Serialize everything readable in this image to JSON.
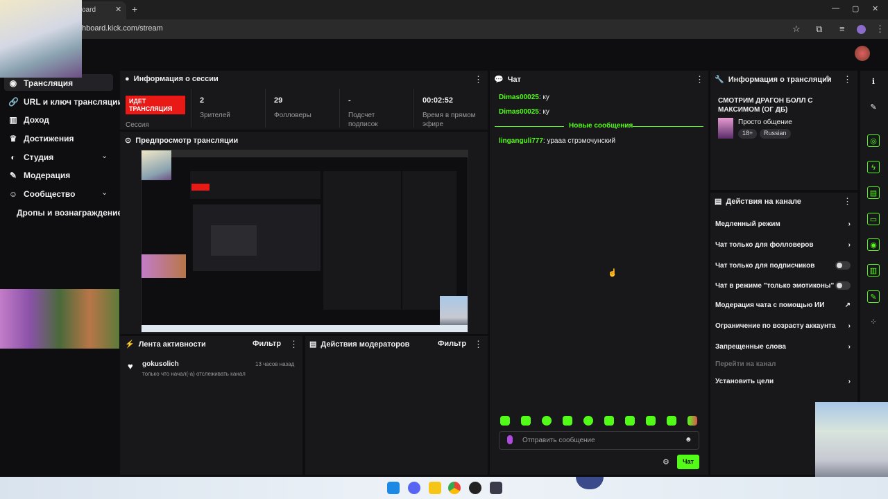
{
  "browser": {
    "tab_title": "oard",
    "tab_close": "✕",
    "new_tab": "+",
    "url": "hboard.kick.com/stream",
    "controls": [
      "—",
      "▢",
      "✕"
    ]
  },
  "sidebar": {
    "items": [
      {
        "label": "Трансляция",
        "icon": "broadcast-icon"
      },
      {
        "label": "URL и ключ трансляции",
        "icon": "link-icon"
      },
      {
        "label": "Доход",
        "icon": "bank-icon"
      },
      {
        "label": "Достижения",
        "icon": "trophy-icon"
      },
      {
        "label": "Студия",
        "icon": "palette-icon",
        "chevron": "⌄"
      },
      {
        "label": "Модерация",
        "icon": "wrench-icon"
      },
      {
        "label": "Сообщество",
        "icon": "people-icon",
        "chevron": "⌄"
      },
      {
        "label": "Дропы и вознаграждение",
        "icon": ""
      }
    ]
  },
  "session": {
    "title": "Информация о сессии",
    "live_badge": "ИДЕТ ТРАНСЛЯЦИЯ",
    "live_label": "Сессия",
    "stats": [
      {
        "value": "2",
        "label": "Зрителей"
      },
      {
        "value": "29",
        "label": "Фолловеры"
      },
      {
        "value": "-",
        "label": "Подсчет подписок"
      },
      {
        "value": "00:02:52",
        "label": "Время в прямом эфире"
      }
    ]
  },
  "preview": {
    "title": "Предпросмотр трансляции"
  },
  "activity": {
    "title": "Лента активности",
    "filter": "Фильтр",
    "items": [
      {
        "user": "gokusolich",
        "time": "13 часов назад",
        "text": "только что начал(-а) отслеживать канал"
      }
    ]
  },
  "modactions": {
    "title": "Действия модераторов",
    "filter": "Фильтр"
  },
  "chat": {
    "title": "Чат",
    "messages": [
      {
        "user": "Dimas00025",
        "text": ": ку"
      },
      {
        "user": "Dimas00025",
        "text": ": ку"
      }
    ],
    "new_messages": "Новые сообщения",
    "new": [
      {
        "user": "linganguli777",
        "text": ": урааа стрэмочунский"
      }
    ],
    "placeholder": "Отправить сообщение",
    "send": "Чат"
  },
  "stream_info": {
    "title": "Информация о трансляции",
    "stream_title": "СМОТРИМ ДРАГОН БОЛЛ С МАКСИМОМ (ОГ ДБ)",
    "category": "Просто общение",
    "tags": [
      "18+",
      "Russian"
    ]
  },
  "channel_actions": {
    "title": "Действия на канале",
    "items": [
      {
        "label": "Медленный режим",
        "control": "›"
      },
      {
        "label": "Чат только для фолловеров",
        "control": "›"
      },
      {
        "label": "Чат только для подписчиков",
        "control": "toggle"
      },
      {
        "label": "Чат в режиме \"только эмотиконы\"",
        "control": "toggle"
      },
      {
        "label": "Модерация чата с помощью ИИ",
        "control": "↗"
      },
      {
        "label": "Ограничение по возрасту аккаунта",
        "control": "›"
      },
      {
        "label": "Запрещенные слова",
        "control": "›"
      },
      {
        "label": "Перейти на канал",
        "control": ""
      },
      {
        "label": "Установить цели",
        "control": "›"
      }
    ]
  },
  "colors": {
    "accent": "#53fc18",
    "live": "#e91916",
    "panel": "#18181b",
    "bg": "#0e0e10"
  }
}
